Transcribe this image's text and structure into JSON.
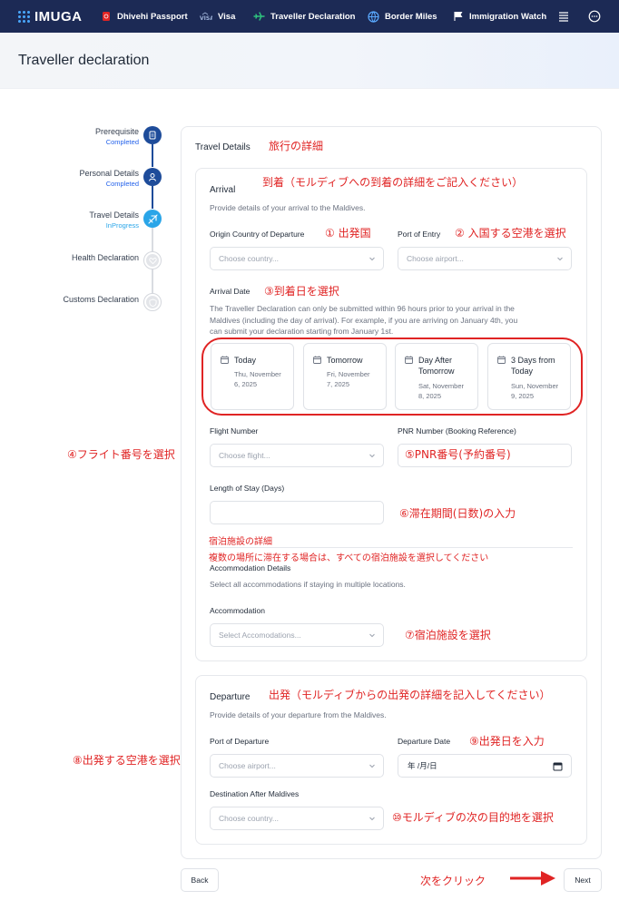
{
  "nav": {
    "logo": "IMUGA",
    "items": [
      {
        "label": "Dhivehi Passport",
        "icon": "passport-icon"
      },
      {
        "label": "Visa",
        "icon": "visa-icon"
      },
      {
        "label": "Traveller Declaration",
        "icon": "airplane-icon"
      },
      {
        "label": "Border Miles",
        "icon": "globe-icon"
      },
      {
        "label": "Immigration Watch",
        "icon": "flag-icon"
      }
    ],
    "extra_icons": [
      "menu-list-icon",
      "chat-icon"
    ]
  },
  "page": {
    "title": "Traveller declaration"
  },
  "stepper": [
    {
      "label": "Prerequisite",
      "status": "Completed"
    },
    {
      "label": "Personal Details",
      "status": "Completed"
    },
    {
      "label": "Travel Details",
      "status": "InProgress"
    },
    {
      "label": "Health Declaration",
      "status": ""
    },
    {
      "label": "Customs Declaration",
      "status": ""
    }
  ],
  "travel": {
    "title": "Travel Details"
  },
  "arrival": {
    "title": "Arrival",
    "desc": "Provide details of your arrival to the Maldives.",
    "origin_label": "Origin Country of Departure",
    "origin_placeholder": "Choose country...",
    "port_label": "Port of Entry",
    "port_placeholder": "Choose airport...",
    "date_label": "Arrival Date",
    "date_desc_1": "The Traveller Declaration can only be submitted within 96 hours prior to your arrival in the",
    "date_desc_2": "Maldives (including the day of arrival). For example, if you are arriving on January 4th, you",
    "date_desc_3": "can submit your declaration starting from January 1st.",
    "days": [
      {
        "title_1": "Today",
        "title_2": "",
        "date_1": "Thu, November",
        "date_2": "6, 2025"
      },
      {
        "title_1": "Tomorrow",
        "title_2": "",
        "date_1": "Fri, November",
        "date_2": "7, 2025"
      },
      {
        "title_1": "Day After",
        "title_2": "Tomorrow",
        "date_1": "Sat, November",
        "date_2": "8, 2025"
      },
      {
        "title_1": "3 Days from",
        "title_2": "Today",
        "date_1": "Sun, November",
        "date_2": "9, 2025"
      }
    ],
    "flight_label": "Flight Number",
    "flight_placeholder": "Choose flight...",
    "pnr_label": "PNR Number (Booking Reference)",
    "stay_label": "Length of Stay (Days)"
  },
  "accommodation": {
    "title": "Accommodation Details",
    "desc": "Select all accommodations if staying in multiple locations.",
    "label": "Accommodation",
    "placeholder": "Select Accomodations..."
  },
  "departure": {
    "title": "Departure",
    "desc": "Provide details of your departure from the Maldives.",
    "port_label": "Port of Departure",
    "port_placeholder": "Choose airport...",
    "date_label": "Departure Date",
    "date_placeholder": "年 /月/日",
    "dest_label": "Destination After Maldives",
    "dest_placeholder": "Choose country..."
  },
  "buttons": {
    "back": "Back",
    "next": "Next"
  },
  "annotations": {
    "travel_details": "旅行の詳細",
    "arrival": "到着（モルディブへの到着の詳細をご記入ください）",
    "origin": "① 出発国",
    "port_entry": "② 入国する空港を選択",
    "arrival_date": "③到着日を選択",
    "flight": "④フライト番号を選択",
    "pnr": "⑤PNR番号(予約番号)",
    "stay": "⑥滞在期間(日数)の入力",
    "accommodation_details": "宿泊施設の詳細",
    "accommodation_multi": "複数の場所に滞在する場合は、すべての宿泊施設を選択してください",
    "accommodation": "⑦宿泊施設を選択",
    "departure": "出発（モルディブからの出発の詳細を記入してください）",
    "port_departure": "⑧出発する空港を選択",
    "departure_date": "⑨出発日を入力",
    "destination": "⑩モルディブの次の目的地を選択",
    "next": "次をクリック"
  },
  "colors": {
    "nav_bg": "#1c2a55",
    "step_done": "#1e4c9a",
    "step_active": "#2aa5e8",
    "annotation": "#e02424",
    "link_blue": "#2563eb"
  }
}
